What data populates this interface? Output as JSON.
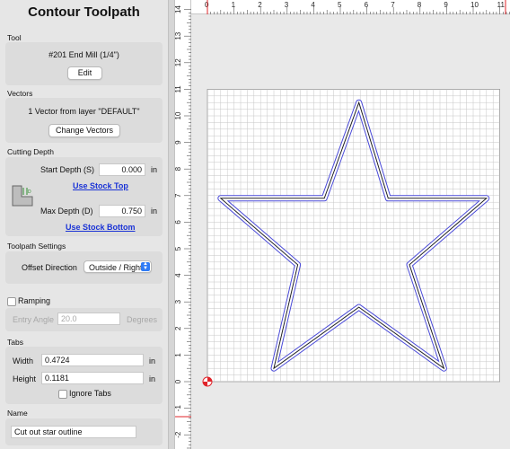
{
  "title": "Contour Toolpath",
  "tool": {
    "section": "Tool",
    "name": "#201 End Mill (1/4\")",
    "edit_label": "Edit"
  },
  "vectors": {
    "section": "Vectors",
    "summary": "1 Vector from layer \"DEFAULT\"",
    "change_label": "Change Vectors"
  },
  "cutting_depth": {
    "section": "Cutting Depth",
    "start_label": "Start Depth (S)",
    "start_value": "0.000",
    "start_unit": "in",
    "use_stock_top": "Use Stock Top",
    "max_label": "Max Depth (D)",
    "max_value": "0.750",
    "max_unit": "in",
    "use_stock_bottom": "Use Stock Bottom"
  },
  "settings": {
    "section": "Toolpath Settings",
    "offset_label": "Offset Direction",
    "offset_value": "Outside / Right"
  },
  "ramping": {
    "label": "Ramping",
    "checked": false,
    "entry_angle_label": "Entry Angle",
    "entry_angle_value": "20.0",
    "entry_angle_unit": "Degrees"
  },
  "tabs": {
    "section": "Tabs",
    "width_label": "Width",
    "width_value": "0.4724",
    "width_unit": "in",
    "height_label": "Height",
    "height_value": "0.1181",
    "height_unit": "in",
    "ignore_label": "Ignore Tabs",
    "ignore_checked": false
  },
  "name": {
    "section": "Name",
    "value": "Cut out star outline"
  },
  "rulers": {
    "horizontal": [
      "0",
      "1",
      "2",
      "3",
      "4",
      "5",
      "6",
      "7",
      "8",
      "9",
      "10",
      "11"
    ],
    "vertical": [
      "14",
      "13",
      "12",
      "11",
      "10",
      "9",
      "8",
      "7",
      "6",
      "5",
      "4",
      "3",
      "2",
      "1",
      "0",
      "-1",
      "-2"
    ]
  },
  "colors": {
    "link": "#1a33d6",
    "toolpath": "#4a4ad8",
    "ruler_marker": "#e0242a",
    "grid_line": "#c6c6c6"
  }
}
